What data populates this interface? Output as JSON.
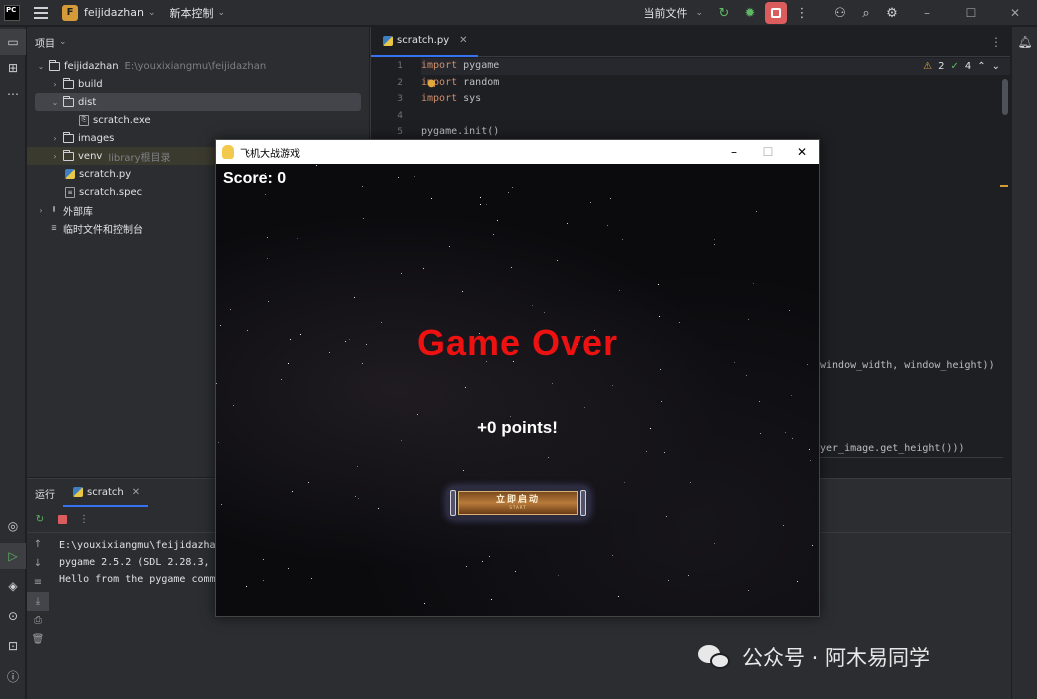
{
  "ide": {
    "logo": "PC",
    "project_badge": "F",
    "project_name": "feijidazhan",
    "vcs_label": "新本控制",
    "run_config": "当前文件",
    "colors": {
      "accent": "#3574f0",
      "stop": "#db5c5c",
      "keyword": "#cf8e6d",
      "warning": "#e0a83a",
      "ok": "#5fb865"
    }
  },
  "project_panel": {
    "title": "项目",
    "root": {
      "name": "feijidazhan",
      "path": "E:\\youxixiangmu\\feijidazhan"
    },
    "items": [
      {
        "name": "build",
        "type": "folder"
      },
      {
        "name": "dist",
        "type": "folder"
      },
      {
        "name": "scratch.exe",
        "type": "exe"
      },
      {
        "name": "images",
        "type": "folder"
      },
      {
        "name": "venv",
        "type": "folder",
        "note": "library根目录"
      },
      {
        "name": "scratch.py",
        "type": "py"
      },
      {
        "name": "scratch.spec",
        "type": "file"
      },
      {
        "name": "外部库",
        "type": "lib"
      },
      {
        "name": "临时文件和控制台",
        "type": "scratch"
      }
    ]
  },
  "editor": {
    "tab": "scratch.py",
    "warnings": "2",
    "checks": "4",
    "lines": [
      {
        "n": "1",
        "kw": "import",
        "rest": " pygame"
      },
      {
        "n": "2",
        "kw": "import",
        "rest": " random"
      },
      {
        "n": "3",
        "kw": "import",
        "rest": " sys"
      },
      {
        "n": "4",
        "kw": "",
        "rest": ""
      },
      {
        "n": "5",
        "kw": "",
        "rest": "pygame.init()"
      }
    ],
    "fragment_1": "window_width, window_height))",
    "fragment_2": "yer_image.get_height()))"
  },
  "run_panel": {
    "title": "运行",
    "tab": "scratch",
    "console": [
      "E:\\youxixiangmu\\feijidazha",
      "pygame 2.5.2 (SDL 2.28.3,",
      "Hello from the pygame comm"
    ]
  },
  "game_window": {
    "title": "飞机大战游戏",
    "score_label": "Score: 0",
    "game_over": "Game Over",
    "points": "+0 points!",
    "start_cn": "立即启动",
    "start_en": "START"
  },
  "watermark": {
    "text": "公众号 · 阿木易同学"
  }
}
